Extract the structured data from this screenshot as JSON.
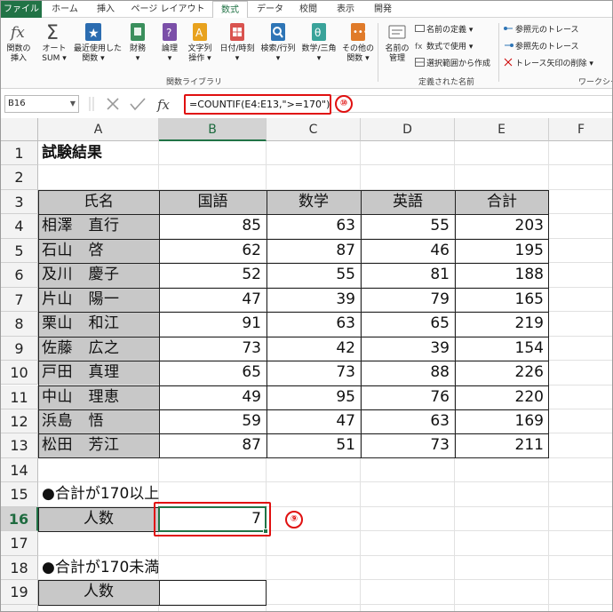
{
  "ribbon": {
    "tabs": [
      "ファイル",
      "ホーム",
      "挿入",
      "ページ レイアウト",
      "数式",
      "データ",
      "校閲",
      "表示",
      "開発"
    ],
    "active_tab": "数式",
    "big_buttons": [
      {
        "label1": "関数の",
        "label2": "挿入",
        "icon": "fx-icon"
      },
      {
        "label1": "オート",
        "label2": "SUM ▾",
        "icon": "sigma-icon"
      },
      {
        "label1": "最近使用した",
        "label2": "関数 ▾",
        "icon": "star-icon"
      },
      {
        "label1": "財務",
        "label2": "▾",
        "icon": "finance-book-icon"
      },
      {
        "label1": "論理",
        "label2": "▾",
        "icon": "logic-book-icon"
      },
      {
        "label1": "文字列",
        "label2": "操作 ▾",
        "icon": "text-book-icon"
      },
      {
        "label1": "日付/時刻",
        "label2": "▾",
        "icon": "calendar-book-icon"
      },
      {
        "label1": "検索/行列",
        "label2": "▾",
        "icon": "lookup-book-icon"
      },
      {
        "label1": "数学/三角",
        "label2": "▾",
        "icon": "math-book-icon"
      },
      {
        "label1": "その他の",
        "label2": "関数 ▾",
        "icon": "more-functions-icon"
      },
      {
        "label1": "名前の",
        "label2": "管理",
        "icon": "name-manager-icon"
      }
    ],
    "small_buttons": [
      {
        "label": "名前の定義 ▾",
        "icon": "define-name-icon"
      },
      {
        "label": "数式で使用 ▾",
        "icon": "use-in-formula-icon"
      },
      {
        "label": "選択範囲から作成",
        "icon": "create-from-selection-icon"
      },
      {
        "label": "参照元のトレース",
        "icon": "trace-precedents-icon"
      },
      {
        "label": "参照先のトレース",
        "icon": "trace-dependents-icon"
      },
      {
        "label": "トレース矢印の削除 ▾",
        "icon": "remove-arrows-icon"
      }
    ],
    "groups": {
      "library": "関数ライブラリ",
      "names": "定義された名前",
      "audit": "ワークシー"
    }
  },
  "formula_bar": {
    "name_box": "B16",
    "fx": "fx",
    "formula": "=COUNTIF(E4:E13,\">=170\")",
    "badge": "⑩"
  },
  "columns": [
    "A",
    "B",
    "C",
    "D",
    "E",
    "F"
  ],
  "selected_column": "B",
  "rows": [
    "1",
    "2",
    "3",
    "4",
    "5",
    "6",
    "7",
    "8",
    "9",
    "10",
    "11",
    "12",
    "13",
    "14",
    "15",
    "16",
    "17",
    "18",
    "19",
    "20"
  ],
  "selected_row": "16",
  "sheet": {
    "title": "試験結果",
    "headers": [
      "氏名",
      "国語",
      "数学",
      "英語",
      "合計"
    ],
    "records": [
      {
        "name": "相澤　直行",
        "kokugo": "85",
        "sugaku": "63",
        "eigo": "55",
        "total": "203"
      },
      {
        "name": "石山　啓",
        "kokugo": "62",
        "sugaku": "87",
        "eigo": "46",
        "total": "195"
      },
      {
        "name": "及川　慶子",
        "kokugo": "52",
        "sugaku": "55",
        "eigo": "81",
        "total": "188"
      },
      {
        "name": "片山　陽一",
        "kokugo": "47",
        "sugaku": "39",
        "eigo": "79",
        "total": "165"
      },
      {
        "name": "栗山　和江",
        "kokugo": "91",
        "sugaku": "63",
        "eigo": "65",
        "total": "219"
      },
      {
        "name": "佐藤　広之",
        "kokugo": "73",
        "sugaku": "42",
        "eigo": "39",
        "total": "154"
      },
      {
        "name": "戸田　真理",
        "kokugo": "65",
        "sugaku": "73",
        "eigo": "88",
        "total": "226"
      },
      {
        "name": "中山　理恵",
        "kokugo": "49",
        "sugaku": "95",
        "eigo": "76",
        "total": "220"
      },
      {
        "name": "浜島　悟",
        "kokugo": "59",
        "sugaku": "47",
        "eigo": "63",
        "total": "169"
      },
      {
        "name": "松田　芳江",
        "kokugo": "87",
        "sugaku": "51",
        "eigo": "73",
        "total": "211"
      }
    ],
    "section1_heading": "●合計が170以上",
    "section1_label": "人数",
    "section1_value": "7",
    "section1_badge": "⑨",
    "section2_heading": "●合計が170未満",
    "section2_label": "人数",
    "section2_value": ""
  },
  "colors": {
    "excel_green": "#217346",
    "highlight_red": "#e01010",
    "label_grey": "#c8c8c8"
  }
}
